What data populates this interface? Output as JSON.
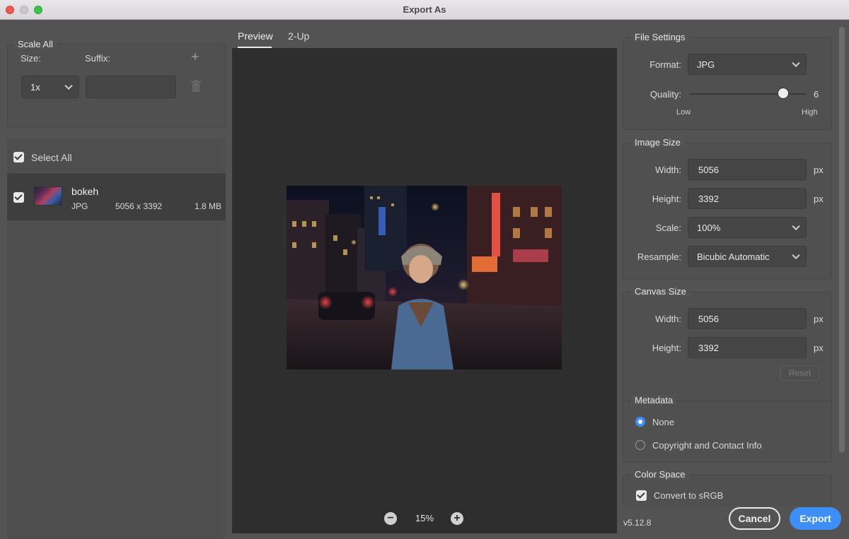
{
  "window": {
    "title": "Export As"
  },
  "scale_all": {
    "title": "Scale All",
    "size_label": "Size:",
    "suffix_label": "Suffix:",
    "size_value": "1x",
    "suffix_value": ""
  },
  "assets": {
    "select_all_label": "Select All",
    "items": [
      {
        "name": "bokeh",
        "format": "JPG",
        "dimensions": "5056 x 3392",
        "size": "1.8 MB"
      }
    ]
  },
  "preview": {
    "tabs": [
      "Preview",
      "2-Up"
    ],
    "zoom": "15%"
  },
  "file_settings": {
    "title": "File Settings",
    "format_label": "Format:",
    "format_value": "JPG",
    "quality_label": "Quality:",
    "quality_value": "6",
    "quality_fraction": 0.9,
    "low_label": "Low",
    "high_label": "High"
  },
  "image_size": {
    "title": "Image Size",
    "width_label": "Width:",
    "width_value": "5056",
    "height_label": "Height:",
    "height_value": "3392",
    "scale_label": "Scale:",
    "scale_value": "100%",
    "resample_label": "Resample:",
    "resample_value": "Bicubic Automatic",
    "unit": "px"
  },
  "canvas_size": {
    "title": "Canvas Size",
    "width_label": "Width:",
    "width_value": "5056",
    "height_label": "Height:",
    "height_value": "3392",
    "unit": "px",
    "reset_label": "Reset"
  },
  "metadata": {
    "title": "Metadata",
    "options": [
      "None",
      "Copyright and Contact Info"
    ],
    "selected": "None"
  },
  "color_space": {
    "title": "Color Space",
    "convert_label": "Convert to sRGB"
  },
  "footer": {
    "version": "v5.12.8",
    "cancel_label": "Cancel",
    "export_label": "Export"
  },
  "colors": {
    "accent": "#3e8ef7",
    "panel": "#535353",
    "preview_bg": "#2e2e2e"
  }
}
